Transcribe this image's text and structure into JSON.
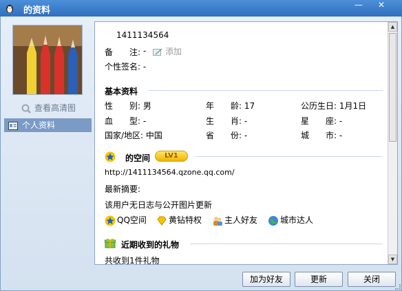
{
  "window": {
    "title": "的资料",
    "minimize_label": "—",
    "close_label": "✕"
  },
  "sidebar": {
    "hd_link": "查看高清图",
    "nav_item": "个人资料"
  },
  "profile": {
    "qq_number": "1411134564",
    "note_label": "备　　注:",
    "note_value": "-",
    "add_note": "添加",
    "signature_label": "个性签名:",
    "signature_value": "-"
  },
  "basic": {
    "title": "基本资料",
    "rows": [
      [
        {
          "label": "性　　别:",
          "value": "男"
        },
        {
          "label": "年　　龄:",
          "value": "17"
        },
        {
          "label": "公历生日:",
          "value": "1月1日"
        }
      ],
      [
        {
          "label": "血　　型:",
          "value": "-"
        },
        {
          "label": "生　　肖:",
          "value": "-"
        },
        {
          "label": "星　　座:",
          "value": "-"
        }
      ],
      [
        {
          "label": "国家/地区:",
          "value": "中国"
        },
        {
          "label": "省　　份:",
          "value": "-"
        },
        {
          "label": "城　　市:",
          "value": "-"
        }
      ]
    ]
  },
  "space": {
    "title": "的空间",
    "level_badge": "LV1",
    "url": "http://1411134564.qzone.qq.com/",
    "summary_label": "最新摘要:",
    "summary_text": "该用户无日志与公开图片更新",
    "links": [
      "QQ空间",
      "黄钻特权",
      "主人好友",
      "城市达人"
    ]
  },
  "gifts": {
    "title": "近期收到的礼物",
    "count_text": "共收到1件礼物"
  },
  "buttons": {
    "add_friend": "加为好友",
    "refresh": "更新",
    "close": "关闭"
  },
  "colors": {
    "titlebar": "#3a7ccc",
    "nav_selected": "#7b9bc6",
    "body_bg": "#dde8f4",
    "badge": "#f5c400"
  }
}
